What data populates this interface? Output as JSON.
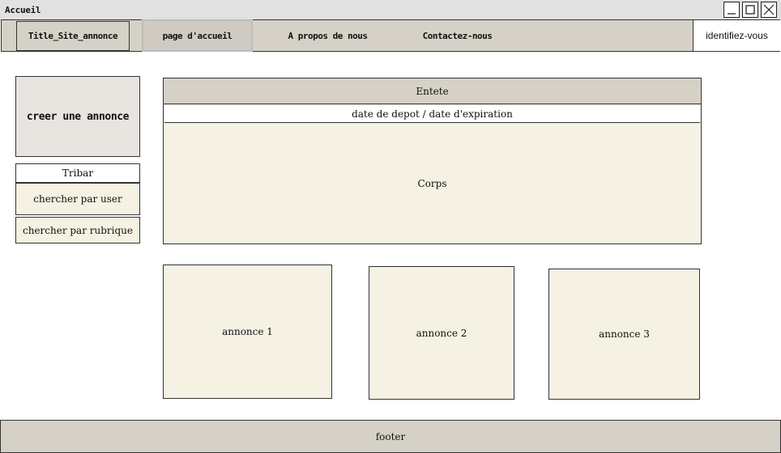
{
  "window": {
    "title": "Accueil",
    "minimize_icon": "minimize-icon",
    "maximize_icon": "maximize-icon",
    "close_icon": "close-icon"
  },
  "nav": {
    "site_title": "Title_Site_annonce",
    "home": "page d'accueil",
    "about": "A propos de nous",
    "contact": "Contactez-nous",
    "login": "identifiez-vous"
  },
  "sidebar": {
    "create": "creer une annonce",
    "tribar": "Tribar",
    "search_user": "chercher par user",
    "search_rubrique": "chercher par rubrique"
  },
  "main": {
    "entete": "Entete",
    "dates": "date de depot / date d'expiration",
    "corps": "Corps"
  },
  "cards": [
    "annonce 1",
    "annonce 2",
    "annonce 3"
  ],
  "footer": "footer",
  "colors": {
    "bar": "#d6d1c7",
    "panel": "#f5f1e3",
    "titlebar": "#e1e1e1"
  }
}
